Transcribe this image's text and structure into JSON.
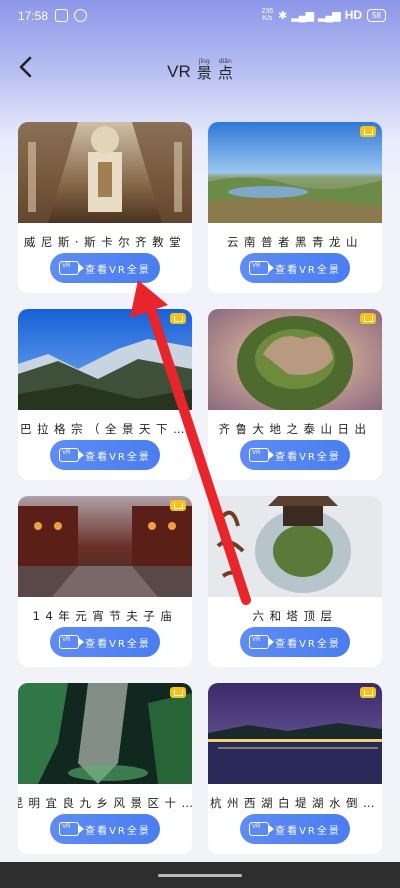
{
  "status_bar": {
    "time": "17:58",
    "net_speed_top": "236",
    "net_speed_bottom": "K/s",
    "network": "HD",
    "battery": "58"
  },
  "header": {
    "title_prefix": "VR",
    "title_chars": [
      {
        "pinyin": "jǐng",
        "hanzi": "景"
      },
      {
        "pinyin": "diǎn",
        "hanzi": "点"
      }
    ]
  },
  "button_label": "查看VR全景",
  "cards": [
    {
      "name": "威尼斯·斯卡尔齐教堂",
      "vip": false
    },
    {
      "name": "云南普者黑青龙山",
      "vip": true
    },
    {
      "name": "巴拉格宗（全景天下…",
      "vip": true
    },
    {
      "name": "齐鲁大地之泰山日出",
      "vip": true
    },
    {
      "name": "14年元宵节夫子庙",
      "vip": true
    },
    {
      "name": "六和塔顶层",
      "vip": false
    },
    {
      "name": "昆明宜良九乡风景区十…",
      "vip": true
    },
    {
      "name": "杭州西湖白堤湖水倒…",
      "vip": true
    }
  ],
  "colors": {
    "accent": "#4a7df0",
    "vip": "#f4c21a",
    "arrow": "#e8252b"
  }
}
